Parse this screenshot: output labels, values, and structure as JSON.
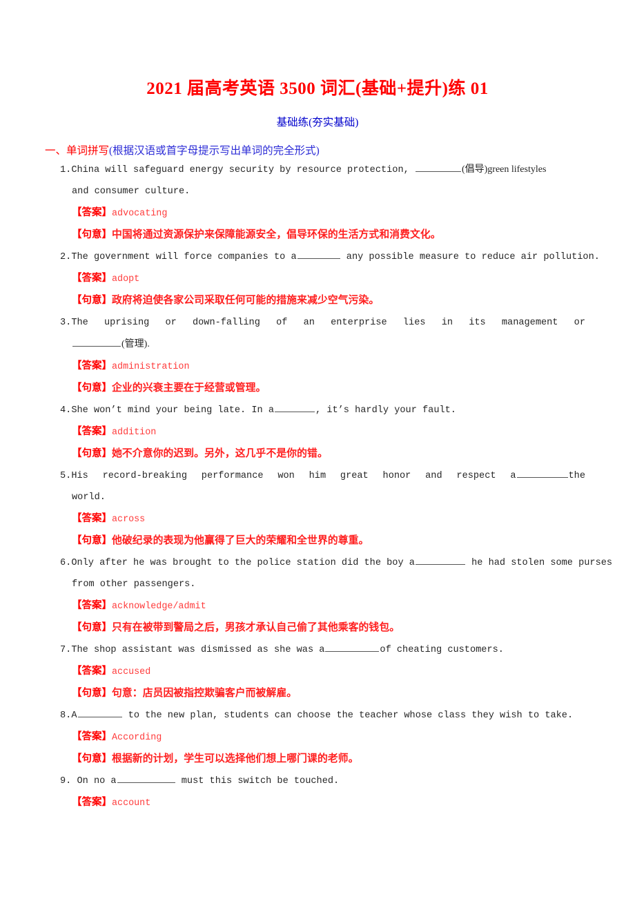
{
  "document": {
    "title": "2021 届高考英语 3500 词汇(基础+提升)练 01",
    "subtitle": "基础练(夯实基础)",
    "section": {
      "main": "一、单词拼写",
      "sub": "(根据汉语或首字母提示写出单词的完全形式)"
    },
    "labels": {
      "answer": "【答案】",
      "meaning": "【句意】"
    },
    "colors": {
      "title_red": "#ff0000",
      "subtitle_blue": "#0000cc",
      "section_sub_blue": "#2b2bd6",
      "answer_red": "#ff2a2a",
      "body_black": "#262626"
    },
    "questions": [
      {
        "number": "1.",
        "line1_a": "China will safeguard energy security by resource protection, ",
        "line1_b": "(倡导)green lifestyles",
        "line2": "and consumer culture.",
        "answer": "advocating",
        "meaning": "中国将通过资源保护来保障能源安全，倡导环保的生活方式和消费文化。"
      },
      {
        "number": "2.",
        "line1_a": "The government will force companies to a",
        "line1_b": " any possible measure to reduce air pollution.",
        "answer": "adopt",
        "meaning": "政府将迫使各家公司采取任何可能的措施来减少空气污染。"
      },
      {
        "number": "3.",
        "line1_a": "The uprising or down-falling of an enterprise lies in its management or",
        "line2_b": "(管理).",
        "answer": "administration",
        "meaning": "企业的兴衰主要在于经营或管理。"
      },
      {
        "number": "4.",
        "line1_a": "She won’t mind your being late. In a",
        "line1_b": ", it’s hardly your fault.",
        "answer": "addition",
        "meaning": "她不介意你的迟到。另外，这几乎不是你的错。"
      },
      {
        "number": "5.",
        "line1_a": "His record-breaking performance won him great honor and respect a",
        "line1_b": "the",
        "line2": "world.",
        "answer": "across",
        "meaning": "他破纪录的表现为他赢得了巨大的荣耀和全世界的尊重。"
      },
      {
        "number": "6.",
        "line1_a": "Only after he was brought to the police station did the boy a",
        "line1_b": " he had stolen some purses",
        "line2": "from other passengers.",
        "answer": "acknowledge/admit",
        "meaning": "只有在被带到警局之后，男孩才承认自己偷了其他乘客的钱包。"
      },
      {
        "number": "7.",
        "line1_a": "The shop assistant was dismissed as she was a",
        "line1_b": "of  cheating customers.",
        "answer": "accused",
        "meaning": "句意：店员因被指控欺骗客户而被解雇。"
      },
      {
        "number": "8.",
        "line1_a": "A",
        "line1_b": " to  the new plan, students can choose the teacher whose class they wish to take.",
        "answer": "According",
        "meaning": "根据新的计划，学生可以选择他们想上哪门课的老师。"
      },
      {
        "number": "9.",
        "line1_a": " On  no  a",
        "line1_b": " must this switch be touched.",
        "answer": "account",
        "meaning": ""
      }
    ]
  }
}
